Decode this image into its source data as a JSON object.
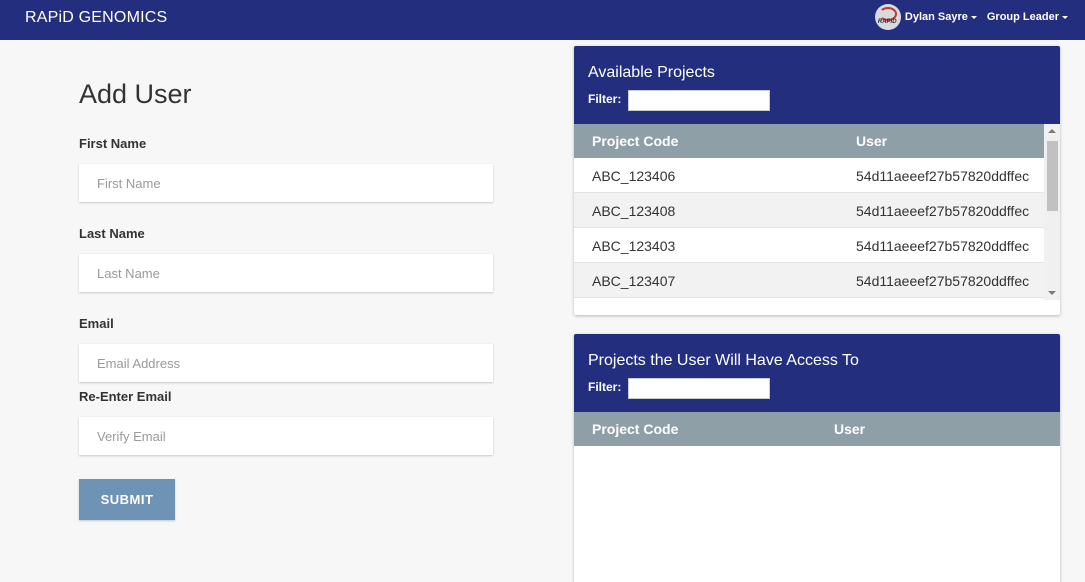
{
  "app": {
    "brand": "RAPiD GENOMICS"
  },
  "user_menu": {
    "avatar_text": "RAPiD",
    "name": "Dylan Sayre",
    "role": "Group Leader"
  },
  "form": {
    "title": "Add User",
    "first_name": {
      "label": "First Name",
      "placeholder": "First Name",
      "value": ""
    },
    "last_name": {
      "label": "Last Name",
      "placeholder": "Last Name",
      "value": ""
    },
    "email": {
      "label": "Email",
      "placeholder": "Email Address",
      "value": ""
    },
    "verify_email": {
      "label": "Re-Enter Email",
      "placeholder": "Verify Email",
      "value": ""
    },
    "submit_label": "SUBMIT"
  },
  "available_projects": {
    "title": "Available Projects",
    "filter_label": "Filter:",
    "filter_value": "",
    "columns": [
      "Project Code",
      "User"
    ],
    "rows": [
      {
        "project_code": "ABC_123406",
        "user": "54d11aeeef27b57820ddffec"
      },
      {
        "project_code": "ABC_123408",
        "user": "54d11aeeef27b57820ddffec"
      },
      {
        "project_code": "ABC_123403",
        "user": "54d11aeeef27b57820ddffec"
      },
      {
        "project_code": "ABC_123407",
        "user": "54d11aeeef27b57820ddffec"
      }
    ]
  },
  "access_projects": {
    "title": "Projects the User Will Have Access To",
    "filter_label": "Filter:",
    "filter_value": "",
    "columns": [
      "Project Code",
      "User"
    ],
    "rows": []
  },
  "colors": {
    "navbar": "#232f7e",
    "table_header": "#8f9fa8",
    "submit_button": "#6f93b4",
    "page_background": "#f7f7f7"
  },
  "icons": [
    "avatar-logo",
    "caret-down-icon",
    "scroll-up-icon",
    "scroll-down-icon"
  ]
}
